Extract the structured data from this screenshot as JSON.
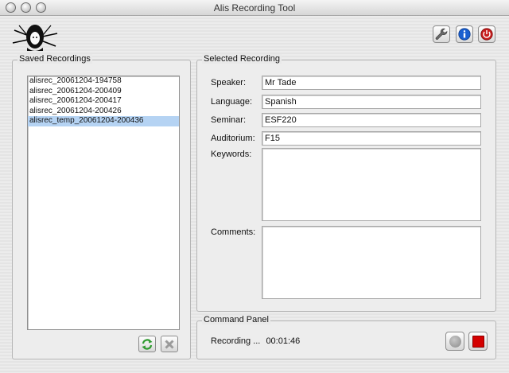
{
  "window": {
    "title": "Alis Recording Tool"
  },
  "toolbar": {
    "settings_icon": "wrench-icon",
    "info_icon": "info-icon",
    "power_icon": "power-icon"
  },
  "saved_recordings": {
    "title": "Saved Recordings",
    "items": [
      "alisrec_20061204-194758",
      "alisrec_20061204-200409",
      "alisrec_20061204-200417",
      "alisrec_20061204-200426",
      "alisrec_temp_20061204-200436"
    ],
    "selected_index": 4
  },
  "selected_recording": {
    "title": "Selected Recording",
    "speaker_label": "Speaker:",
    "speaker_value": "Mr Tade",
    "language_label": "Language:",
    "language_value": "Spanish",
    "seminar_label": "Seminar:",
    "seminar_value": "ESF220",
    "auditorium_label": "Auditorium:",
    "auditorium_value": "F15",
    "keywords_label": "Keywords:",
    "keywords_value": "",
    "comments_label": "Comments:",
    "comments_value": ""
  },
  "command_panel": {
    "title": "Command Panel",
    "status_text": "Recording ...",
    "elapsed": "00:01:46"
  },
  "colors": {
    "selection": "#b5d3f3",
    "stop_red": "#d40000",
    "info_blue": "#1a5fd0",
    "power_red": "#c81e1e"
  }
}
